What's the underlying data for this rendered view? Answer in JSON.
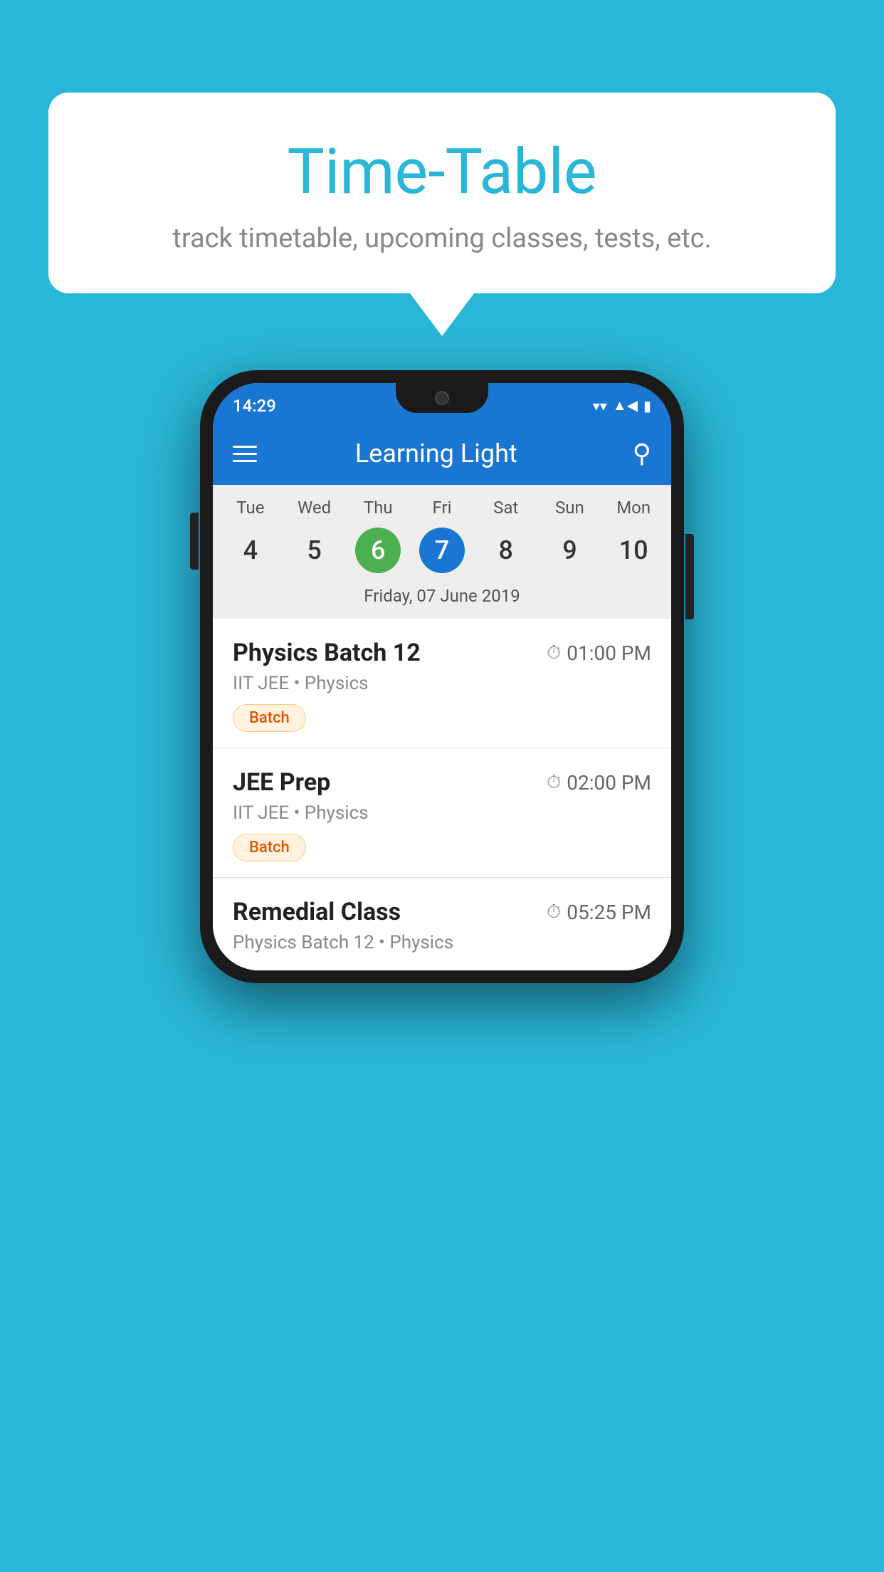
{
  "background": {
    "color": "#29b6d8"
  },
  "speech_bubble": {
    "title": "Time-Table",
    "subtitle": "track timetable, upcoming classes, tests, etc."
  },
  "phone": {
    "status_bar": {
      "time": "14:29"
    },
    "app_bar": {
      "title": "Learning Light"
    },
    "calendar": {
      "days": [
        {
          "label": "Tue",
          "number": "4"
        },
        {
          "label": "Wed",
          "number": "5"
        },
        {
          "label": "Thu",
          "number": "6",
          "state": "today"
        },
        {
          "label": "Fri",
          "number": "7",
          "state": "selected"
        },
        {
          "label": "Sat",
          "number": "8"
        },
        {
          "label": "Sun",
          "number": "9"
        },
        {
          "label": "Mon",
          "number": "10"
        }
      ],
      "selected_date": "Friday, 07 June 2019"
    },
    "schedule": [
      {
        "title": "Physics Batch 12",
        "time": "01:00 PM",
        "subtitle": "IIT JEE • Physics",
        "tag": "Batch"
      },
      {
        "title": "JEE Prep",
        "time": "02:00 PM",
        "subtitle": "IIT JEE • Physics",
        "tag": "Batch"
      },
      {
        "title": "Remedial Class",
        "time": "05:25 PM",
        "subtitle": "Physics Batch 12 • Physics",
        "tag": null
      }
    ]
  }
}
